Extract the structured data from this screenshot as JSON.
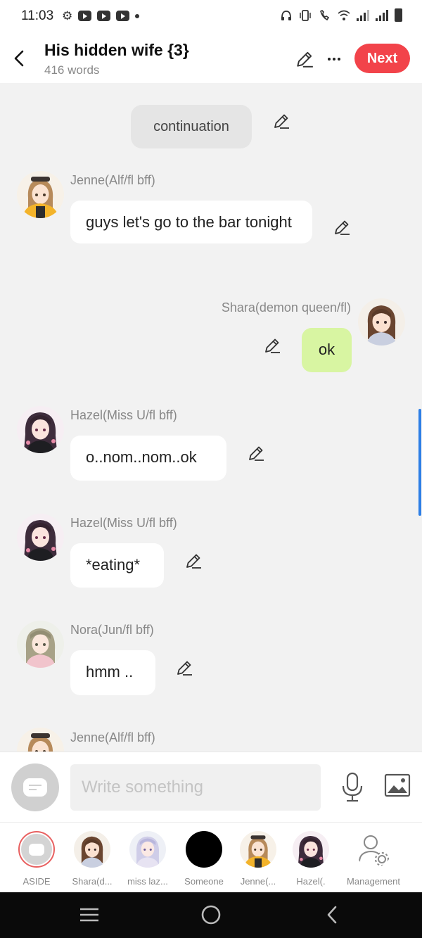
{
  "status_bar": {
    "time": "11:03"
  },
  "header": {
    "title": "His hidden wife {3}",
    "word_count": "416 words",
    "next_label": "Next"
  },
  "messages": [
    {
      "kind": "narration",
      "text": "continuation"
    },
    {
      "kind": "character",
      "sender": "Jenne(Alf/fl bff)",
      "text": "guys let's go to the bar tonight",
      "avatar": "jenne-avatar"
    },
    {
      "kind": "self",
      "sender": "Shara(demon queen/fl)",
      "text": "ok",
      "avatar": "shara-avatar"
    },
    {
      "kind": "character",
      "sender": "Hazel(Miss U/fl bff)",
      "text": "o..nom..nom..ok",
      "avatar": "hazel-avatar"
    },
    {
      "kind": "character",
      "sender": "Hazel(Miss U/fl bff)",
      "text": "*eating*",
      "avatar": "hazel-avatar"
    },
    {
      "kind": "character",
      "sender": "Nora(Jun/fl bff)",
      "text": "hmm ..",
      "avatar": "nora-avatar"
    },
    {
      "kind": "character",
      "sender": "Jenne(Alf/fl bff)",
      "text": "",
      "avatar": "jenne-avatar"
    }
  ],
  "composer": {
    "placeholder": "Write something"
  },
  "characters": [
    {
      "label": "ASIDE",
      "icon": "aside-icon"
    },
    {
      "label": "Shara(d...",
      "icon": "shara-avatar"
    },
    {
      "label": "miss laz...",
      "icon": "miss-laz-avatar"
    },
    {
      "label": "Someone",
      "icon": "someone-avatar"
    },
    {
      "label": "Jenne(...",
      "icon": "jenne-avatar"
    },
    {
      "label": "Hazel(.",
      "icon": "hazel-avatar"
    },
    {
      "label": "Management",
      "icon": "management-icon"
    }
  ],
  "colors": {
    "accent": "#f2434a",
    "self_bubble": "#d8f5a2",
    "scroll_indicator": "#2e7fe6"
  }
}
